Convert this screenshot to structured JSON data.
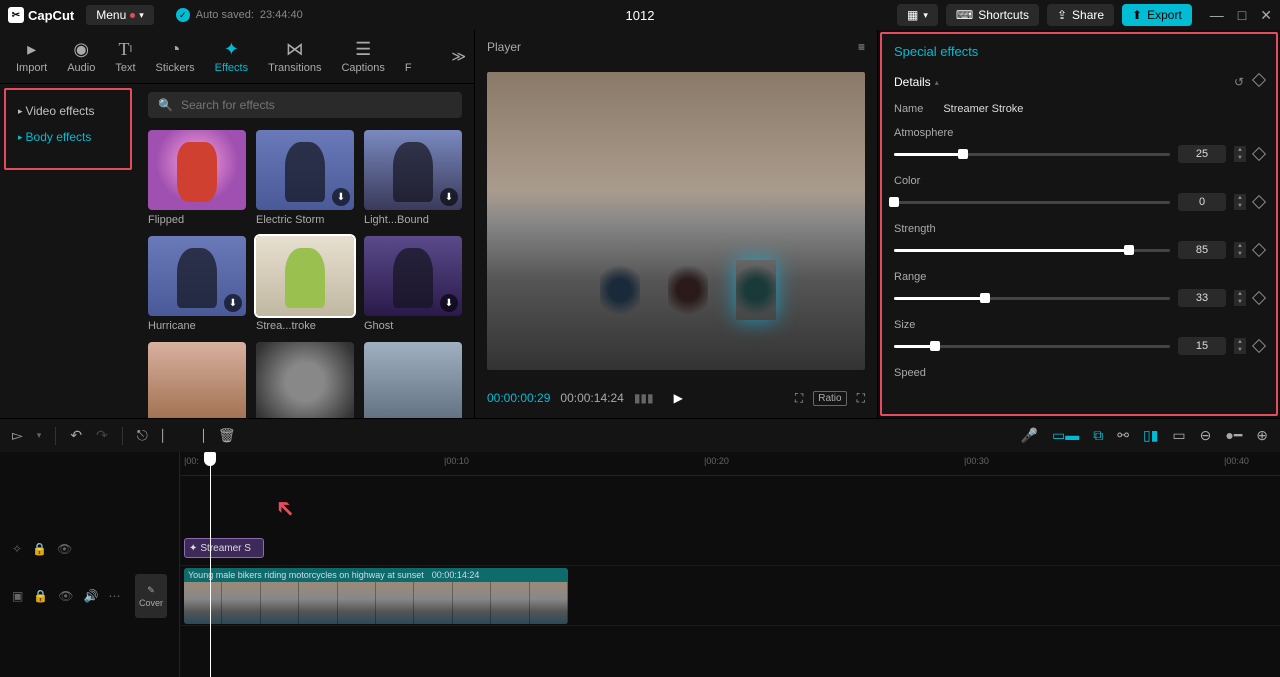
{
  "app": {
    "name": "CapCut"
  },
  "menu": {
    "label": "Menu"
  },
  "autosave": {
    "prefix": "Auto saved:",
    "time": "23:44:40"
  },
  "project": {
    "title": "1012"
  },
  "topbar": {
    "shortcuts": "Shortcuts",
    "share": "Share",
    "export": "Export"
  },
  "tooltabs": {
    "import": "Import",
    "audio": "Audio",
    "text": "Text",
    "stickers": "Stickers",
    "effects": "Effects",
    "transitions": "Transitions",
    "captions": "Captions",
    "f": "F"
  },
  "effect_categories": {
    "video": "Video effects",
    "body": "Body effects"
  },
  "search": {
    "placeholder": "Search for effects"
  },
  "effects": [
    {
      "label": "Flipped"
    },
    {
      "label": "Electric Storm"
    },
    {
      "label": "Light...Bound"
    },
    {
      "label": "Hurricane"
    },
    {
      "label": "Strea...troke"
    },
    {
      "label": "Ghost"
    },
    {
      "label": ""
    },
    {
      "label": ""
    },
    {
      "label": ""
    }
  ],
  "player": {
    "title": "Player",
    "time_current": "00:00:00:29",
    "time_total": "00:00:14:24",
    "ratio": "Ratio"
  },
  "right_panel": {
    "title": "Special effects",
    "details": "Details",
    "name_label": "Name",
    "name_value": "Streamer Stroke",
    "params": [
      {
        "label": "Atmosphere",
        "value": 25,
        "pct": 25
      },
      {
        "label": "Color",
        "value": 0,
        "pct": 0
      },
      {
        "label": "Strength",
        "value": 85,
        "pct": 85
      },
      {
        "label": "Range",
        "value": 33,
        "pct": 33
      },
      {
        "label": "Size",
        "value": 15,
        "pct": 15
      }
    ],
    "speed_label": "Speed"
  },
  "timeline": {
    "ruler": [
      "|00:",
      "|00:10",
      "|00:20",
      "|00:30",
      "|00:40"
    ],
    "effect_clip": "Streamer S",
    "video_clip_title": "Young male bikers riding motorcycles on highway at sunset",
    "video_clip_duration": "00:00:14:24",
    "cover": "Cover"
  }
}
